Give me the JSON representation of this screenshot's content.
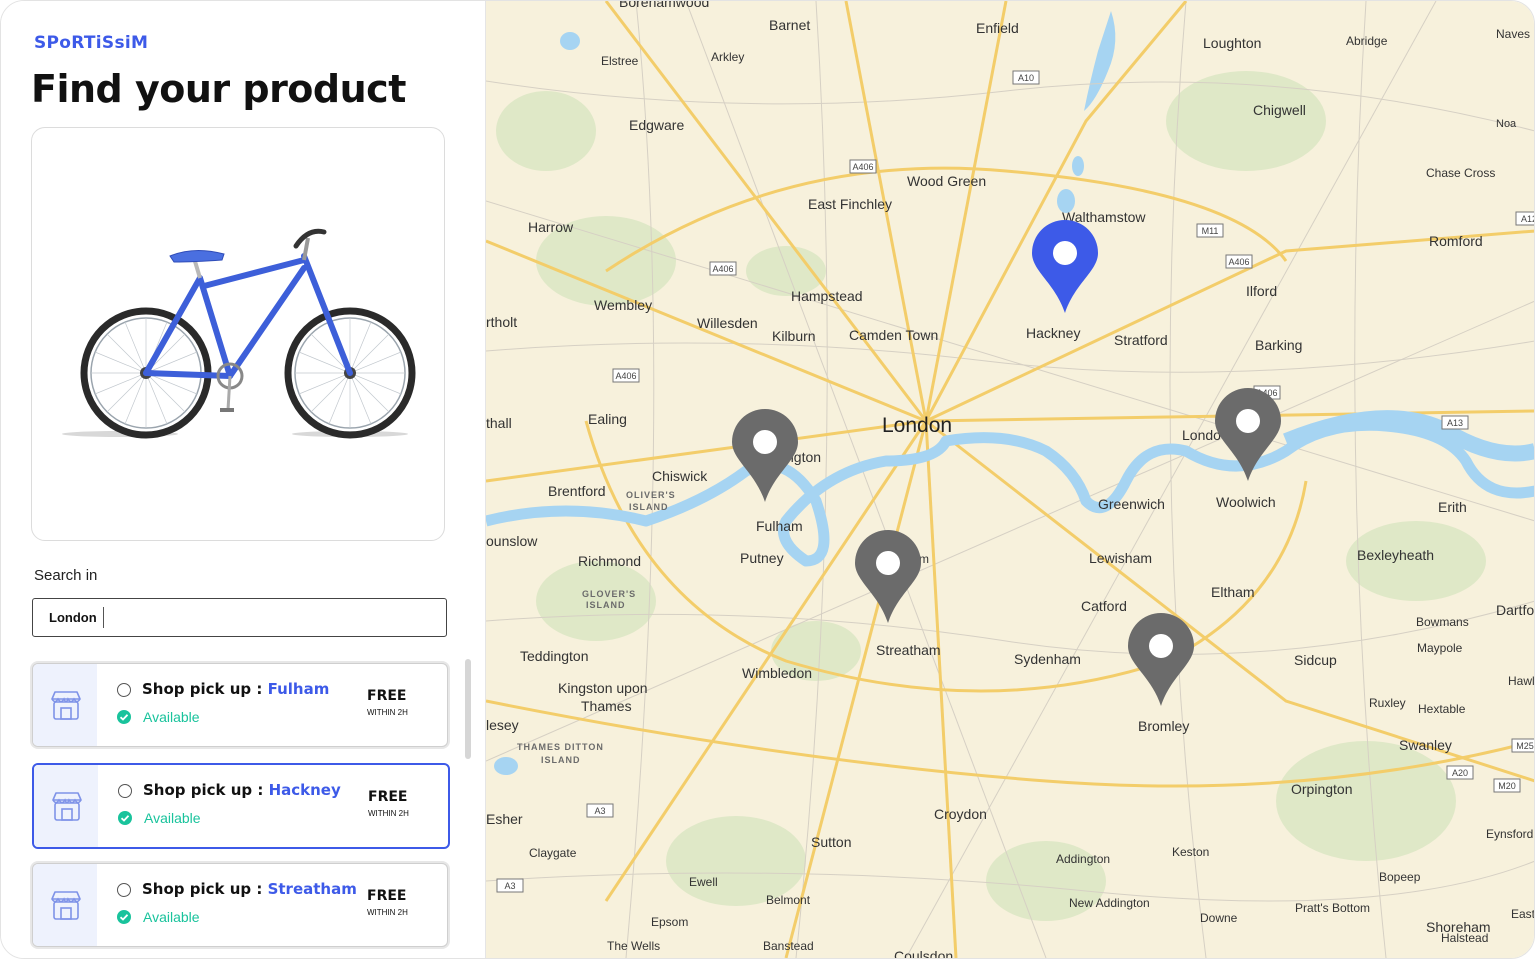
{
  "brand": "SPoRTiSsiM",
  "page_title": "Find your product",
  "search": {
    "label": "Search in",
    "value": "London"
  },
  "shops": [
    {
      "prefix": "Shop pick up : ",
      "city": "Fulham",
      "status": "Available",
      "price": "FREE",
      "delivery": "WITHIN 2H",
      "selected": false
    },
    {
      "prefix": "Shop pick up : ",
      "city": "Hackney",
      "status": "Available",
      "price": "FREE",
      "delivery": "WITHIN 2H",
      "selected": true
    },
    {
      "prefix": "Shop pick up : ",
      "city": "Streatham",
      "status": "Available",
      "price": "FREE",
      "delivery": "WITHIN 2H",
      "selected": false
    }
  ],
  "map": {
    "main_label": "London",
    "place_labels": [
      "Borehamwood",
      "Barnet",
      "Enfield",
      "Loughton",
      "Abridge",
      "Naves",
      "Elstree",
      "Arkley",
      "Edgware",
      "Chigwell",
      "Noa",
      "Wood Green",
      "Chase Cross",
      "East Finchley",
      "Harrow",
      "Walthamstow",
      "Romford",
      "Ilford",
      "Wembley",
      "Hampstead",
      "Willesden",
      "Kilburn",
      "Camden Town",
      "Hackney",
      "Stratford",
      "Barking",
      "rtholt",
      "thall",
      "Ealing",
      "ngton",
      "Chiswick",
      "Brentford",
      "Fulham",
      "Greenwich",
      "Woolwich",
      "Erith",
      "ounslow",
      "Richmond",
      "Putney",
      "Lewisham",
      "Bexleyheath",
      "Eltham",
      "Catford",
      "Dartfo",
      "Bowmans",
      "Maypole",
      "Teddington",
      "Wimbledon",
      "Streatham",
      "Sydenham",
      "Sidcup",
      "Hawl",
      "Kingston upon",
      "Thames",
      "Bromley",
      "Ruxley",
      "Hextable",
      "lesey",
      "Swanley",
      "Orpington",
      "Esher",
      "Croydon",
      "Sutton",
      "Eynsford",
      "Claygate",
      "Addington",
      "Keston",
      "Bopeep",
      "Ewell",
      "Belmont",
      "New Addington",
      "Pratt's Bottom",
      "Downe",
      "East",
      "Epsom",
      "Shoreham",
      "Halstead",
      "The Wells",
      "Banstead",
      "Coulsdon",
      "Londo",
      "m"
    ],
    "island_labels": [
      "OLIVER'S",
      "ISLAND",
      "GLOVER'S",
      "ISLAND",
      "THAMES DITTON",
      "ISLAND"
    ],
    "road_labels": [
      "A10",
      "A406",
      "M11",
      "A406",
      "A12",
      "A406",
      "A406",
      "A406",
      "A13",
      "M25",
      "A20",
      "M20",
      "A3",
      "A3"
    ],
    "pins": [
      {
        "name": "Hackney",
        "state": "selected",
        "color": "#3d5ae8"
      },
      {
        "name": "Fulham",
        "state": "default",
        "color": "#6b6b6b"
      },
      {
        "name": "Streatham",
        "state": "default",
        "color": "#6b6b6b"
      },
      {
        "name": "Woolwich",
        "state": "default",
        "color": "#6b6b6b"
      },
      {
        "name": "Bromley",
        "state": "default",
        "color": "#6b6b6b"
      }
    ]
  },
  "icons": {
    "shop": "storefront-icon",
    "status": "check-circle-icon",
    "pin": "map-pin-icon"
  },
  "colors": {
    "accent": "#3d5ae8",
    "available": "#19c39c",
    "pin_default": "#6b6b6b",
    "water": "#a6d4f2"
  }
}
